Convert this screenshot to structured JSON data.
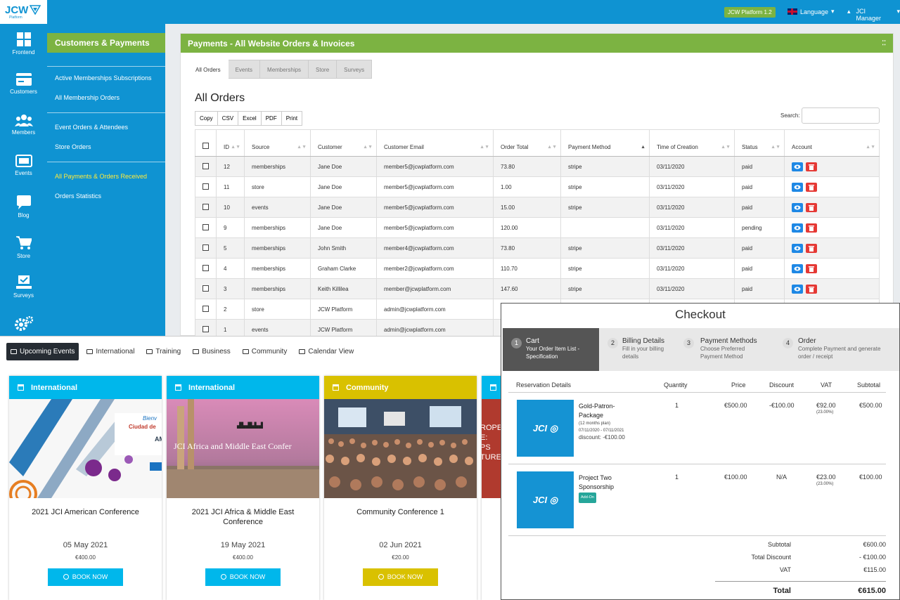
{
  "header": {
    "logo": "JCW",
    "logo_sub": "Platform",
    "platform_badge": "JCW Platform 1.2",
    "language_label": "Language",
    "user_label": "JCI Manager"
  },
  "iconbar": [
    {
      "label": "Frontend",
      "icon": "grid-icon"
    },
    {
      "label": "Customers",
      "icon": "card-icon"
    },
    {
      "label": "Members",
      "icon": "people-icon"
    },
    {
      "label": "Events",
      "icon": "ticket-icon"
    },
    {
      "label": "Blog",
      "icon": "chat-icon"
    },
    {
      "label": "Store",
      "icon": "cart-icon"
    },
    {
      "label": "Surveys",
      "icon": "survey-icon"
    },
    {
      "label": "",
      "icon": "gears-icon"
    }
  ],
  "subnav": {
    "title": "Customers & Payments",
    "links": [
      "Active Memberships Subscriptions",
      "All Membership Orders",
      "Event Orders & Attendees",
      "Store Orders",
      "All Payments & Orders Received",
      "Orders Statistics"
    ]
  },
  "panel": {
    "title": "Payments - All Website Orders & Invoices",
    "tabs": [
      "All Orders",
      "Events",
      "Memberships",
      "Store",
      "Surveys"
    ],
    "heading": "All Orders",
    "export_buttons": [
      "Copy",
      "CSV",
      "Excel",
      "PDF",
      "Print"
    ],
    "search_label": "Search:",
    "columns": [
      "ID",
      "Source",
      "Customer",
      "Customer Email",
      "Order Total",
      "Payment Method",
      "Time of Creation",
      "Status",
      "Account"
    ],
    "rows": [
      {
        "id": "12",
        "source": "memberships",
        "customer": "Jane Doe",
        "email": "member5@jcwplatform.com",
        "total": "73.80",
        "method": "stripe",
        "created": "03/11/2020",
        "status": "paid"
      },
      {
        "id": "11",
        "source": "store",
        "customer": "Jane Doe",
        "email": "member5@jcwplatform.com",
        "total": "1.00",
        "method": "stripe",
        "created": "03/11/2020",
        "status": "paid"
      },
      {
        "id": "10",
        "source": "events",
        "customer": "Jane Doe",
        "email": "member5@jcwplatform.com",
        "total": "15.00",
        "method": "stripe",
        "created": "03/11/2020",
        "status": "paid"
      },
      {
        "id": "9",
        "source": "memberships",
        "customer": "Jane Doe",
        "email": "member5@jcwplatform.com",
        "total": "120.00",
        "method": "",
        "created": "03/11/2020",
        "status": "pending"
      },
      {
        "id": "5",
        "source": "memberships",
        "customer": "John Smith",
        "email": "member4@jcwplatform.com",
        "total": "73.80",
        "method": "stripe",
        "created": "03/11/2020",
        "status": "paid"
      },
      {
        "id": "4",
        "source": "memberships",
        "customer": "Graham Clarke",
        "email": "member2@jcwplatform.com",
        "total": "110.70",
        "method": "stripe",
        "created": "03/11/2020",
        "status": "paid"
      },
      {
        "id": "3",
        "source": "memberships",
        "customer": "Keith Killilea",
        "email": "member@jcwplatform.com",
        "total": "147.60",
        "method": "stripe",
        "created": "03/11/2020",
        "status": "paid"
      },
      {
        "id": "2",
        "source": "store",
        "customer": "JCW Platform",
        "email": "admin@jcwplatform.com",
        "total": "",
        "method": "",
        "created": "",
        "status": ""
      },
      {
        "id": "1",
        "source": "events",
        "customer": "JCW Platform",
        "email": "admin@jcwplatform.com",
        "total": "",
        "method": "",
        "created": "",
        "status": ""
      }
    ]
  },
  "events": {
    "tabs": [
      "Upcoming Events",
      "International",
      "Training",
      "Business",
      "Community",
      "Calendar View"
    ],
    "cards": [
      {
        "category": "International",
        "color": "#00b7eb",
        "title": "2021 JCI American Conference",
        "date": "05 May 2021",
        "price": "€400.00",
        "cta": "BOOK NOW",
        "image_text": "Bienv Ciudad de AME"
      },
      {
        "category": "International",
        "color": "#00b7eb",
        "title": "2021 JCI Africa & Middle East Conference",
        "date": "19 May 2021",
        "price": "€400.00",
        "cta": "BOOK NOW",
        "image_text": "JCI Africa and Middle East Confer"
      },
      {
        "category": "Community",
        "color": "#d9c100",
        "title": "Community Conference 1",
        "date": "02 Jun 2021",
        "price": "€20.00",
        "cta": "BOOK NOW",
        "image_text": ""
      },
      {
        "category": "",
        "color": "#00b7eb",
        "title": "",
        "date": "",
        "price": "",
        "cta": "",
        "image_text": "ROPE E: PS TURE"
      }
    ]
  },
  "checkout": {
    "title": "Checkout",
    "steps": [
      {
        "num": "1",
        "title": "Cart",
        "desc": "Your Order Item List - Specification"
      },
      {
        "num": "2",
        "title": "Billing Details",
        "desc": "Fill in your billing details"
      },
      {
        "num": "3",
        "title": "Payment Methods",
        "desc": "Choose Preferred Payment Method"
      },
      {
        "num": "4",
        "title": "Order",
        "desc": "Complete Payment and generate order / receipt"
      }
    ],
    "columns": [
      "Reservation Details",
      "Quantity",
      "Price",
      "Discount",
      "VAT",
      "Subtotal"
    ],
    "items": [
      {
        "logo": "JCI",
        "name": "Gold-Patron-Package",
        "meta1": "(12 months plan)",
        "meta2": "07/11/2020 - 07/11/2021",
        "meta3": "discount: -€100.00",
        "qty": "1",
        "price": "€500.00",
        "discount": "-€100.00",
        "vat": "€92.00",
        "vat_pct": "(23.00%)",
        "subtotal": "€500.00"
      },
      {
        "logo": "JCI",
        "name": "Project Two Sponsorship",
        "badge": "Add-On",
        "qty": "1",
        "price": "€100.00",
        "discount": "N/A",
        "vat": "€23.00",
        "vat_pct": "(23.00%)",
        "subtotal": "€100.00"
      }
    ],
    "totals": {
      "subtotal_label": "Subtotal",
      "subtotal": "€600.00",
      "discount_label": "Total Discount",
      "discount": "- €100.00",
      "vat_label": "VAT",
      "vat": "€115.00",
      "total_label": "Total",
      "total": "€615.00"
    }
  }
}
